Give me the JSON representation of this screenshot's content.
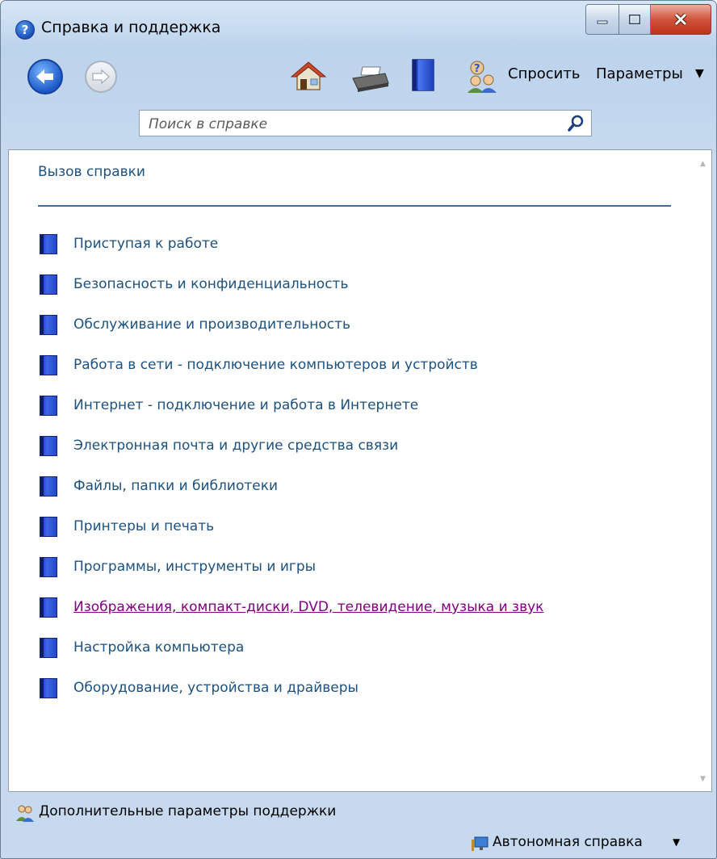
{
  "window": {
    "title": "Справка и поддержка"
  },
  "toolbar": {
    "home_icon": "home-icon",
    "print_icon": "printer-icon",
    "browse_icon": "book-icon",
    "ask_label": "Спросить",
    "options_label": "Параметры"
  },
  "search": {
    "placeholder": "Поиск в справке"
  },
  "content": {
    "help_call_link": "Вызов справки",
    "topics": [
      {
        "label": "Приступая к работе",
        "visited": false
      },
      {
        "label": "Безопасность и конфиденциальность",
        "visited": false
      },
      {
        "label": "Обслуживание и производительность",
        "visited": false
      },
      {
        "label": "Работа в сети - подключение компьютеров и устройств",
        "visited": false
      },
      {
        "label": "Интернет - подключение и работа в Интернете",
        "visited": false
      },
      {
        "label": "Электронная почта и другие средства связи",
        "visited": false
      },
      {
        "label": "Файлы, папки и библиотеки",
        "visited": false
      },
      {
        "label": "Принтеры и печать",
        "visited": false
      },
      {
        "label": "Программы, инструменты и игры",
        "visited": false
      },
      {
        "label": "Изображения, компакт-диски, DVD, телевидение, музыка и звук",
        "visited": true
      },
      {
        "label": "Настройка компьютера",
        "visited": false
      },
      {
        "label": "Оборудование, устройства и драйверы",
        "visited": false
      }
    ]
  },
  "footer": {
    "support_label": "Дополнительные параметры поддержки",
    "offline_label": "Автономная справка"
  },
  "colors": {
    "link": "#1c5180",
    "visited_link": "#800080",
    "rule": "#3a6ea5",
    "chrome": "#c6d9ef"
  }
}
